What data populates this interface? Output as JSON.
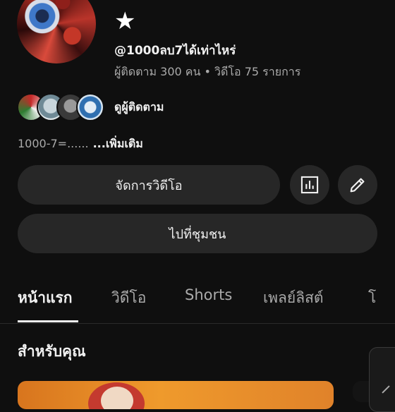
{
  "channel": {
    "name": "★",
    "handle": "@1000ลบ7ได้เท่าไหร่",
    "stats": "ผู้ติดตาม 300 คน • วิดีโอ 75 รายการ",
    "subscribers_link": "ดูผู้ติดตาม",
    "description": "1000-7=......",
    "more_label": "...เพิ่มเติม"
  },
  "actions": {
    "manage_videos": "จัดการวิดีโอ",
    "go_community": "ไปที่ชุมชน",
    "analytics_icon": "bar-chart-icon",
    "edit_icon": "pencil-icon"
  },
  "tabs": [
    {
      "label": "หน้าแรก",
      "active": true
    },
    {
      "label": "วิดีโอ",
      "active": false
    },
    {
      "label": "Shorts",
      "active": false
    },
    {
      "label": "เพลย์ลิสต์",
      "active": false
    },
    {
      "label": "โ",
      "active": false
    }
  ],
  "section": {
    "title": "สำหรับคุณ"
  },
  "colors": {
    "background": "#0f0f0f",
    "pill": "#272727",
    "text": "#f1f1f1",
    "muted": "#aaaaaa"
  }
}
